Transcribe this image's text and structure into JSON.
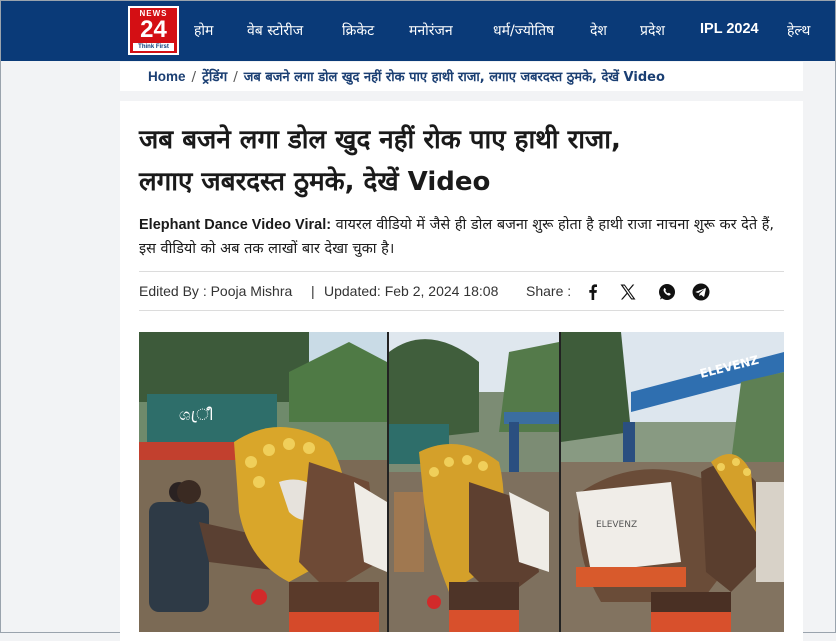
{
  "brand": {
    "logo_top": "NEWS",
    "logo_num": "24",
    "logo_tagline": "Think First"
  },
  "nav": {
    "items": [
      "होम",
      "वेब स्टोरीज",
      "क्रिकेट",
      "मनोरंजन",
      "धर्म/ज्योतिष",
      "देश",
      "प्रदेश",
      "IPL 2024",
      "हेल्थ"
    ]
  },
  "breadcrumb": {
    "home": "Home",
    "section": "ट्रेंडिंग",
    "current": "जब बजने लगा डोल खुद नहीं रोक पाए हाथी राजा, लगाए जबरदस्त ठुमके, देखें Video"
  },
  "article": {
    "title_line1": "जब बजने लगा डोल खुद नहीं रोक पाए हाथी राजा,",
    "title_line2": "लगाए जबरदस्त ठुमके, देखें Video",
    "lead_bold": "Elephant Dance Video Viral:",
    "lead_text": " वायरल वीडियो में जैसे ही डोल बजना शुरू होता है हाथी राजा नाचना शुरू कर देते हैं, इस वीडियो को अब तक लाखों बार देखा चुका है।",
    "edited_by": "Edited By : Pooja Mishra",
    "separator": "|",
    "updated": "Updated: Feb 2, 2024 18:08",
    "share_label": "Share :"
  },
  "share_icons": [
    "facebook-icon",
    "x-icon",
    "whatsapp-icon",
    "telegram-icon"
  ],
  "video": {
    "banner_text": "ELEVENZ",
    "sign_text": "ශ്രീ",
    "cloth_text": "ELEVENZ"
  },
  "colors": {
    "nav_bg": "#0a3a78",
    "logo_red": "#d40f14",
    "crumb_text": "#1b3f73"
  }
}
